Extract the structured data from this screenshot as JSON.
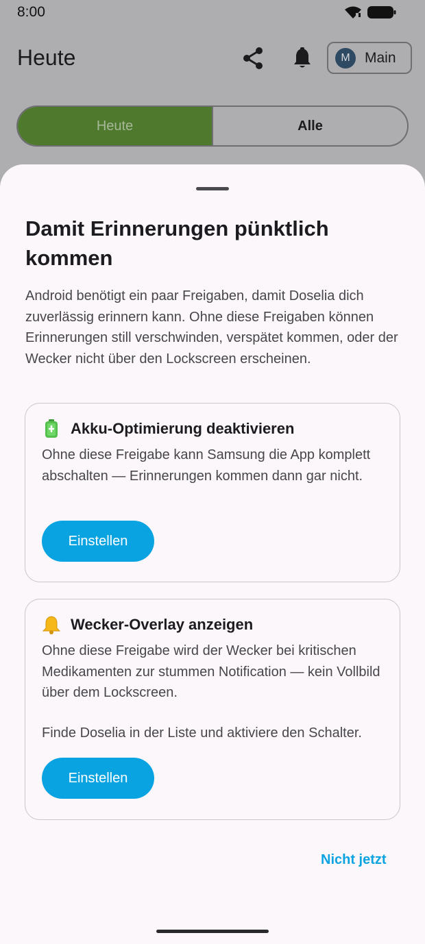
{
  "status_bar": {
    "time": "8:00"
  },
  "app_bar": {
    "title": "Heute",
    "profile": {
      "initial": "M",
      "label": "Main"
    }
  },
  "tabs": [
    {
      "label": "Heute",
      "selected": true
    },
    {
      "label": "Alle",
      "selected": false
    }
  ],
  "sheet": {
    "title": "Damit Erinnerungen pünktlich kommen",
    "description": "Android benötigt ein paar Freigaben, damit Doselia dich zuverlässig erinnern kann. Ohne diese Freigaben können Erinnerungen still verschwinden, verspätet kommen, oder der Wecker nicht über den Lockscreen erscheinen.",
    "cards": [
      {
        "icon": "battery-icon",
        "title": "Akku-Optimierung deaktivieren",
        "text": "Ohne diese Freigabe kann Samsung die App komplett abschalten — Erinnerungen kommen dann gar nicht.",
        "button_label": "Einstellen"
      },
      {
        "icon": "bell-icon",
        "title": "Wecker-Overlay anzeigen",
        "text": "Ohne diese Freigabe wird der Wecker bei kritischen Medikamenten zur stummen Notification — kein Vollbild über dem Lockscreen.",
        "hint": "Finde Doselia in der Liste und aktiviere den Schalter.",
        "button_label": "Einstellen"
      }
    ],
    "dismiss_label": "Nicht jetzt"
  },
  "colors": {
    "accent": "#0aa3e2",
    "tab_active": "#4f7a2e",
    "scrim_background": "#aeadb0",
    "sheet_background": "#fbf7fb"
  }
}
